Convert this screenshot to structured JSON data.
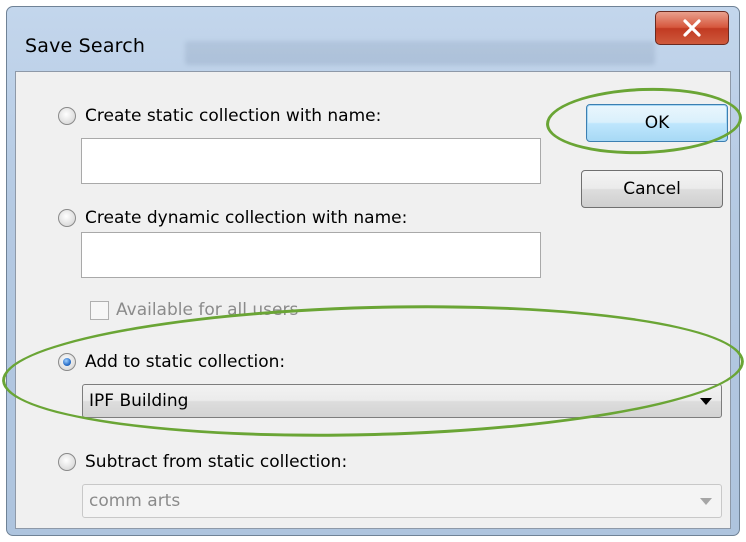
{
  "dialog": {
    "title": "Save Search",
    "ok_label": "OK",
    "cancel_label": "Cancel"
  },
  "options": {
    "static_new": {
      "label": "Create static collection with name:",
      "checked": false,
      "value": ""
    },
    "dynamic_new": {
      "label": "Create dynamic collection with name:",
      "checked": false,
      "value": ""
    },
    "available_all_users": {
      "label": "Available for all users",
      "checked": false,
      "enabled": false
    },
    "add_static": {
      "label": "Add to static collection:",
      "checked": true,
      "selected": "IPF Building"
    },
    "subtract_static": {
      "label": "Subtract from static collection:",
      "checked": false,
      "selected": "comm arts",
      "enabled": false
    }
  },
  "colors": {
    "highlight": "#6aa535",
    "close_button": "#c13a22",
    "title_bar": "#b4c9e2",
    "client_bg": "#f0f0f0"
  }
}
